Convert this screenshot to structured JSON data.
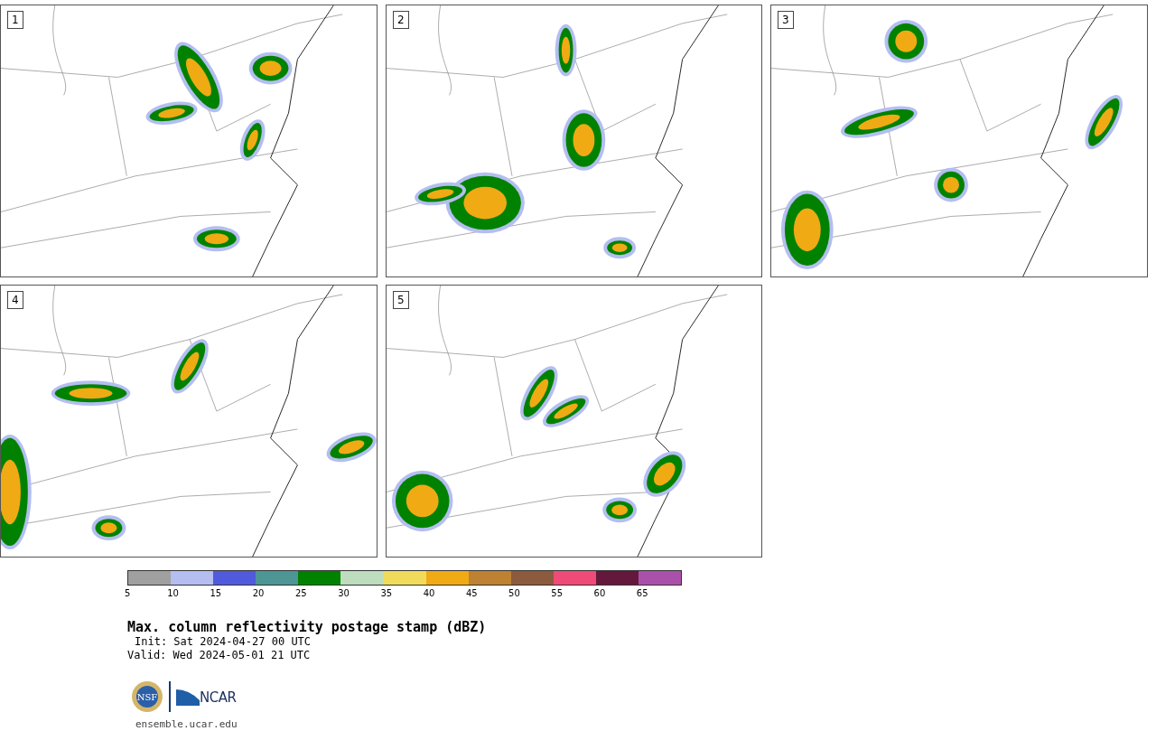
{
  "panels": [
    {
      "label": "1"
    },
    {
      "label": "2"
    },
    {
      "label": "3"
    },
    {
      "label": "4"
    },
    {
      "label": "5"
    }
  ],
  "colorbar": {
    "segments": [
      {
        "color": "#a0a0a0"
      },
      {
        "color": "#b4bef0"
      },
      {
        "color": "#505adc"
      },
      {
        "color": "#4e9696"
      },
      {
        "color": "#008200"
      },
      {
        "color": "#bedcbe"
      },
      {
        "color": "#f0dc5a"
      },
      {
        "color": "#f0aa14"
      },
      {
        "color": "#be8232"
      },
      {
        "color": "#8c5a3c"
      },
      {
        "color": "#f04b78"
      },
      {
        "color": "#64193c"
      },
      {
        "color": "#aa50aa"
      }
    ],
    "ticks": [
      "5",
      "10",
      "15",
      "20",
      "25",
      "30",
      "35",
      "40",
      "45",
      "50",
      "55",
      "60",
      "65"
    ]
  },
  "title": "Max. column reflectivity postage stamp (dBZ)",
  "init": "Init: Sat 2024-04-27 00 UTC",
  "valid": "Valid: Wed 2024-05-01 21 UTC",
  "logo": {
    "seal_text": "NSF",
    "text": "NCAR"
  },
  "url": "ensemble.ucar.edu"
}
